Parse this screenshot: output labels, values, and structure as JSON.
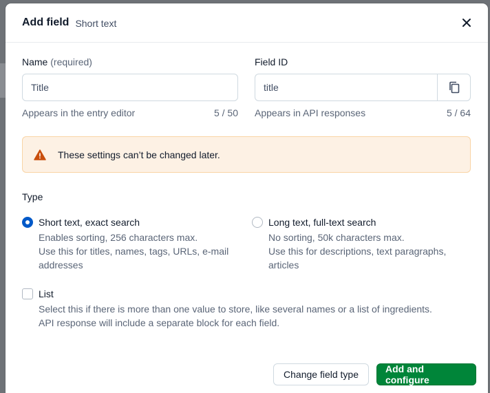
{
  "modal": {
    "title": "Add field",
    "subtitle": "Short text",
    "close_icon": "close-icon"
  },
  "name_field": {
    "label": "Name",
    "required_note": "(required)",
    "value": "Title",
    "help": "Appears in the entry editor",
    "count": "5 / 50"
  },
  "id_field": {
    "label": "Field ID",
    "value": "title",
    "help": "Appears in API responses",
    "count": "5 / 64",
    "copy_icon": "copy-icon"
  },
  "warning": {
    "text": "These settings can’t be changed later.",
    "icon": "warning-icon",
    "color": "#c94f0d"
  },
  "type": {
    "label": "Type",
    "options": [
      {
        "title": "Short text, exact search",
        "desc_lines": [
          "Enables sorting, 256 characters max.",
          "Use this for titles, names, tags, URLs, e-mail",
          "addresses"
        ],
        "selected": true
      },
      {
        "title": "Long text, full-text search",
        "desc_lines": [
          "No sorting, 50k characters max.",
          "Use this for descriptions, text paragraphs,",
          "articles"
        ],
        "selected": false
      }
    ]
  },
  "list_option": {
    "title": "List",
    "desc_lines": [
      "Select this if there is more than one value to store, like several names or a list of ingredients.",
      "API response will include a separate block for each field."
    ],
    "checked": false
  },
  "footer": {
    "secondary_label": "Change field type",
    "primary_label": "Add and configure"
  },
  "colors": {
    "primary": "#008539",
    "accent": "#0059c8"
  }
}
